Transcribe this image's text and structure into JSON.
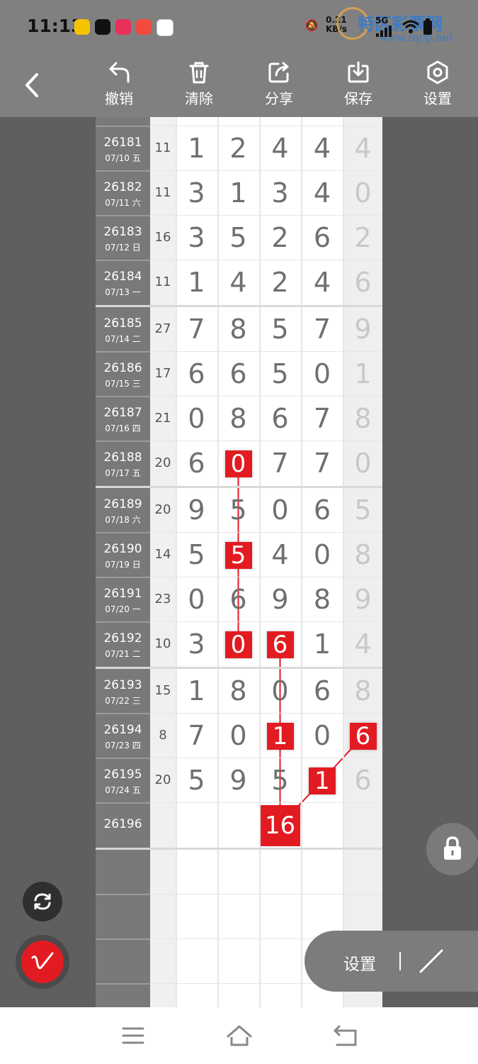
{
  "status_bar": {
    "time": "11:13",
    "speed_value": "0.21",
    "speed_unit": "KB/s",
    "network": "5G",
    "watermark_title": "特区彩票网",
    "watermark_url": "www.tqcp.net"
  },
  "toolbar": {
    "undo_label": "撤销",
    "clear_label": "清除",
    "share_label": "分享",
    "save_label": "保存",
    "settings_label": "设置"
  },
  "rows": [
    {
      "issue": "26181",
      "date": "07/10 五",
      "sum": "11",
      "digits": [
        "1",
        "2",
        "4",
        "4"
      ],
      "extra": "4"
    },
    {
      "issue": "26182",
      "date": "07/11 六",
      "sum": "11",
      "digits": [
        "3",
        "1",
        "3",
        "4"
      ],
      "extra": "0"
    },
    {
      "issue": "26183",
      "date": "07/12 日",
      "sum": "16",
      "digits": [
        "3",
        "5",
        "2",
        "6"
      ],
      "extra": "2"
    },
    {
      "issue": "26184",
      "date": "07/13 一",
      "sum": "11",
      "digits": [
        "1",
        "4",
        "2",
        "4"
      ],
      "extra": "6"
    },
    {
      "issue": "26185",
      "date": "07/14 二",
      "sum": "27",
      "digits": [
        "7",
        "8",
        "5",
        "7"
      ],
      "extra": "9"
    },
    {
      "issue": "26186",
      "date": "07/15 三",
      "sum": "17",
      "digits": [
        "6",
        "6",
        "5",
        "0"
      ],
      "extra": "1"
    },
    {
      "issue": "26187",
      "date": "07/16 四",
      "sum": "21",
      "digits": [
        "0",
        "8",
        "6",
        "7"
      ],
      "extra": "8"
    },
    {
      "issue": "26188",
      "date": "07/17 五",
      "sum": "20",
      "digits": [
        "6",
        "0",
        "7",
        "7"
      ],
      "extra": "0"
    },
    {
      "issue": "26189",
      "date": "07/18 六",
      "sum": "20",
      "digits": [
        "9",
        "5",
        "0",
        "6"
      ],
      "extra": "5"
    },
    {
      "issue": "26190",
      "date": "07/19 日",
      "sum": "14",
      "digits": [
        "5",
        "5",
        "4",
        "0"
      ],
      "extra": "8"
    },
    {
      "issue": "26191",
      "date": "07/20 一",
      "sum": "23",
      "digits": [
        "0",
        "6",
        "9",
        "8"
      ],
      "extra": "9"
    },
    {
      "issue": "26192",
      "date": "07/21 二",
      "sum": "10",
      "digits": [
        "3",
        "0",
        "6",
        "1"
      ],
      "extra": "4"
    },
    {
      "issue": "26193",
      "date": "07/22 三",
      "sum": "15",
      "digits": [
        "1",
        "8",
        "0",
        "6"
      ],
      "extra": "8"
    },
    {
      "issue": "26194",
      "date": "07/23 四",
      "sum": "8",
      "digits": [
        "7",
        "0",
        "1",
        "0"
      ],
      "extra": "6"
    },
    {
      "issue": "26195",
      "date": "07/24 五",
      "sum": "20",
      "digits": [
        "5",
        "9",
        "5",
        "1"
      ],
      "extra": "6"
    },
    {
      "issue": "26196",
      "date": "",
      "sum": "",
      "digits": [
        "",
        "",
        "",
        ""
      ],
      "extra": ""
    }
  ],
  "highlights": [
    {
      "row": 7,
      "col": 1,
      "value": "0"
    },
    {
      "row": 9,
      "col": 1,
      "value": "5"
    },
    {
      "row": 11,
      "col": 1,
      "value": "0"
    },
    {
      "row": 11,
      "col": 2,
      "value": "6"
    },
    {
      "row": 13,
      "col": 2,
      "value": "1"
    },
    {
      "row": 13,
      "col": 4,
      "value": "6"
    },
    {
      "row": 14,
      "col": 3,
      "value": "1"
    }
  ],
  "prediction": {
    "value": "16"
  },
  "floating": {
    "settings_label": "设置"
  },
  "colors": {
    "accent": "#e21b22",
    "toolbar": "#808080",
    "date_column": "#797979"
  }
}
